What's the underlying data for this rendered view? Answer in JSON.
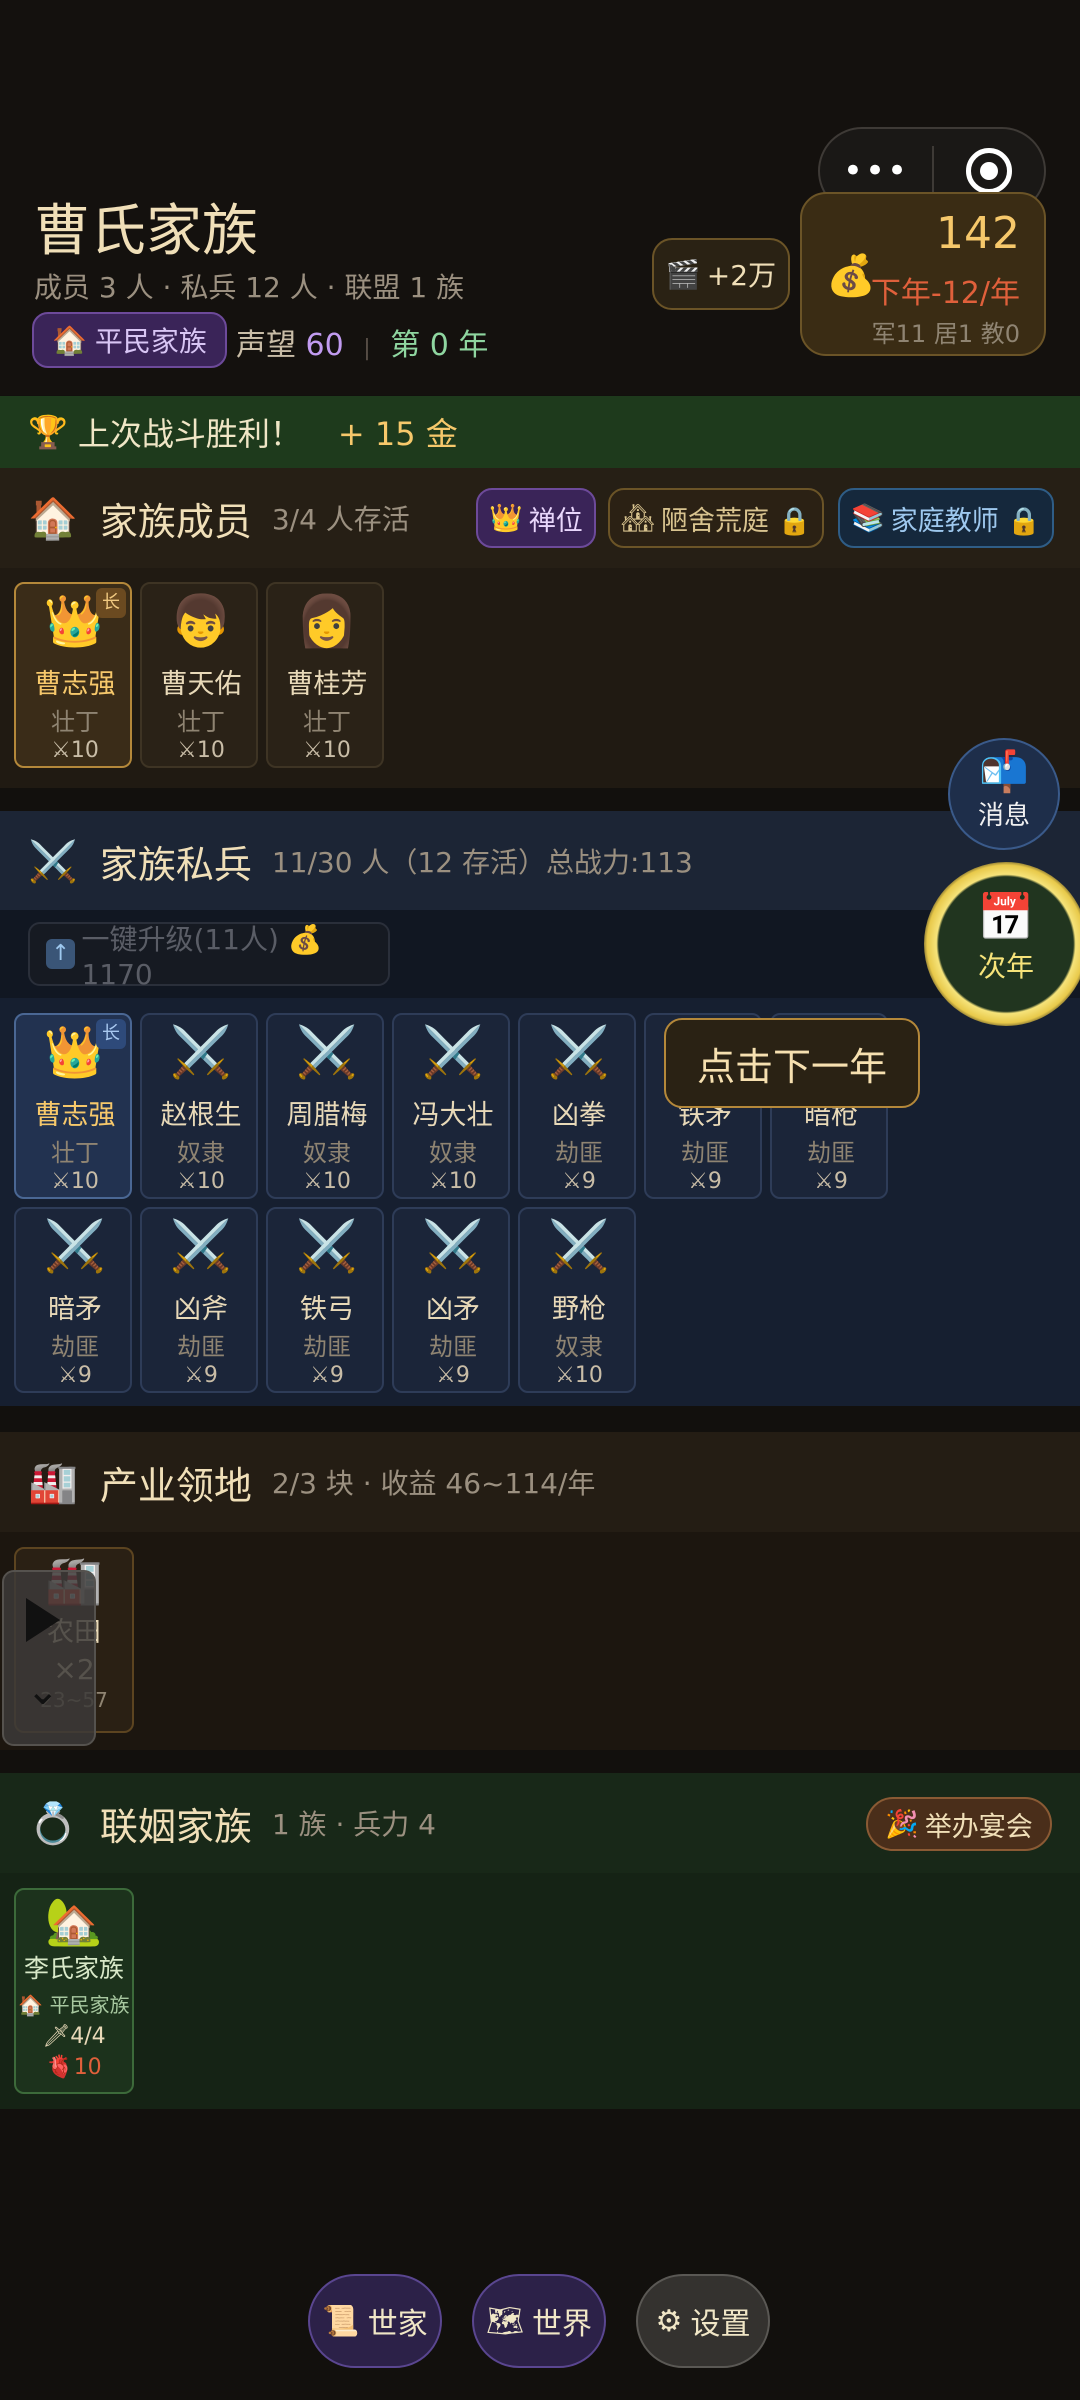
{
  "header": {
    "family_name": "曹氏家族",
    "sub_info": "成员 3 人 · 私兵 12 人 · 联盟 1 族",
    "rank_label": "平民家族",
    "reputation_label": "声望",
    "reputation_value": "60",
    "year_label": "第 0 年",
    "ad_reward": "+2万",
    "money": "142",
    "rate": "下年-12/年",
    "population": "军11 居1 教0"
  },
  "victory": {
    "text": "上次战斗胜利！",
    "gold": "+ 15 金"
  },
  "family": {
    "title": "家族成员",
    "meta": "3/4 人存活",
    "chip_throne": "禅位",
    "chip_house": "陋舍荒庭 🔒",
    "chip_teacher": "家庭教师 🔒",
    "members": [
      {
        "name": "曹志强",
        "role": "壮丁",
        "power": "⚔10",
        "tag": "长",
        "avatar": "👑"
      },
      {
        "name": "曹天佑",
        "role": "壮丁",
        "power": "⚔10",
        "tag": "",
        "avatar": "👦"
      },
      {
        "name": "曹桂芳",
        "role": "壮丁",
        "power": "⚔10",
        "tag": "",
        "avatar": "👩"
      }
    ]
  },
  "soldiers": {
    "title": "家族私兵",
    "meta": "11/30 人（12 存活）总战力:113",
    "upgrade": "一键升级(11人) 💰1170",
    "list": [
      {
        "name": "曹志强",
        "role": "壮丁",
        "power": "⚔10",
        "tag": "长",
        "avatar": "👑"
      },
      {
        "name": "赵根生",
        "role": "奴隶",
        "power": "⚔10",
        "tag": "",
        "avatar": "⚔️"
      },
      {
        "name": "周腊梅",
        "role": "奴隶",
        "power": "⚔10",
        "tag": "",
        "avatar": "⚔️"
      },
      {
        "name": "冯大壮",
        "role": "奴隶",
        "power": "⚔10",
        "tag": "",
        "avatar": "⚔️"
      },
      {
        "name": "凶拳",
        "role": "劫匪",
        "power": "⚔9",
        "tag": "",
        "avatar": "⚔️"
      },
      {
        "name": "铁矛",
        "role": "劫匪",
        "power": "⚔9",
        "tag": "",
        "avatar": "⚔️"
      },
      {
        "name": "暗枪",
        "role": "劫匪",
        "power": "⚔9",
        "tag": "",
        "avatar": "⚔️"
      },
      {
        "name": "暗矛",
        "role": "劫匪",
        "power": "⚔9",
        "tag": "",
        "avatar": "⚔️"
      },
      {
        "name": "凶斧",
        "role": "劫匪",
        "power": "⚔9",
        "tag": "",
        "avatar": "⚔️"
      },
      {
        "name": "铁弓",
        "role": "劫匪",
        "power": "⚔9",
        "tag": "",
        "avatar": "⚔️"
      },
      {
        "name": "凶矛",
        "role": "劫匪",
        "power": "⚔9",
        "tag": "",
        "avatar": "⚔️"
      },
      {
        "name": "野枪",
        "role": "奴隶",
        "power": "⚔10",
        "tag": "",
        "avatar": "⚔️"
      }
    ]
  },
  "industry": {
    "title": "产业领地",
    "meta": "2/3 块 · 收益 46~114/年",
    "card": {
      "name": "农田",
      "count": "×2",
      "range": "23~57"
    }
  },
  "alliance": {
    "title": "联姻家族",
    "meta": "1 族 · 兵力 4",
    "feast": "举办宴会",
    "card": {
      "name": "李氏家族",
      "rank": "🏠 平民家族",
      "soldiers": "🗡4/4",
      "hp": "🫀10"
    }
  },
  "floating": {
    "message": "消息",
    "next_year": "次年",
    "tooltip": "点击下一年"
  },
  "nav": {
    "shijia": "世家",
    "shijie": "世界",
    "settings": "设置"
  },
  "icons": {
    "rank": "house-icon",
    "ad": "clapper-icon",
    "money": "money-bag-icon",
    "trophy": "trophy-icon",
    "family": "house-icon",
    "soldiers": "crossed-swords-icon",
    "industry": "factory-icon",
    "alliance": "ring-icon",
    "message": "mailbox-icon",
    "calendar": "calendar-icon",
    "scroll": "scroll-icon",
    "map": "map-icon",
    "gear": "gear-icon"
  }
}
